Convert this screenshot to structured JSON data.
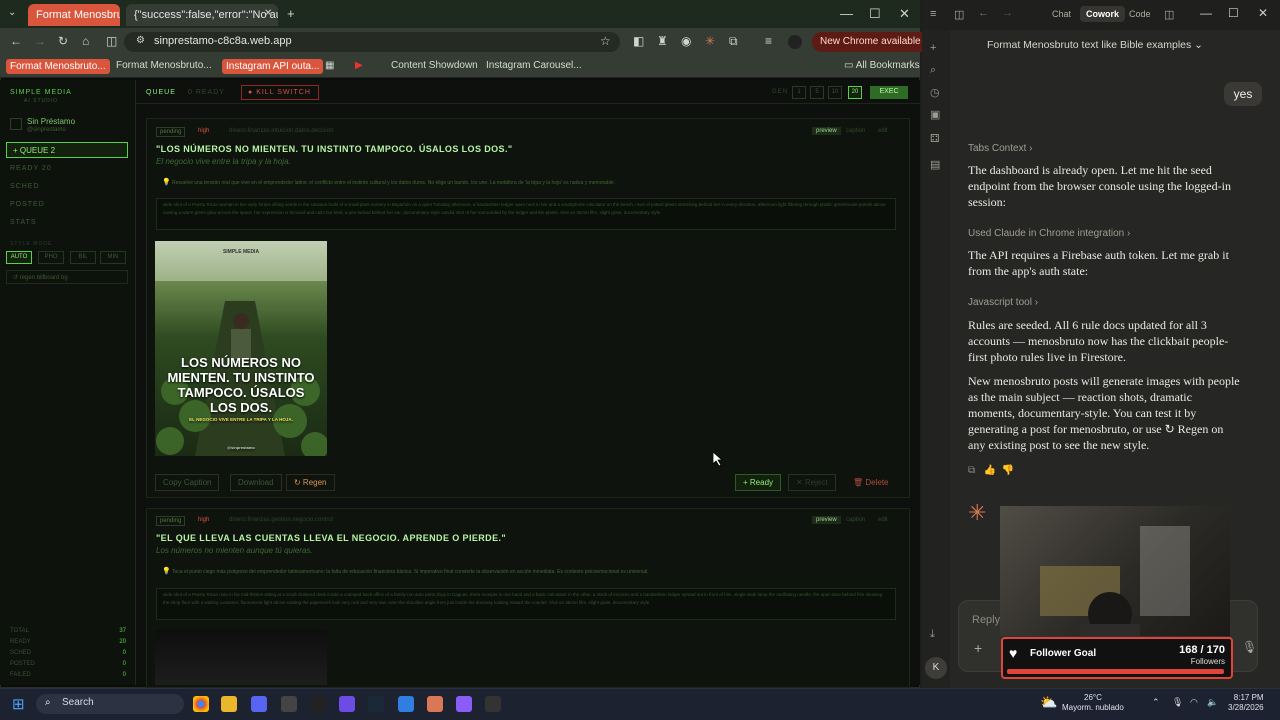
{
  "browser": {
    "tabs": [
      {
        "label": "Format Menosbruto"
      },
      {
        "label": "{\"success\":false,\"error\":\"No auth"
      }
    ],
    "url": "sinprestamo-c8c8a.web.app",
    "new_chrome": "New Chrome available",
    "bookmarks": [
      "Format Menosbruto...",
      "Format Menosbruto...",
      "Instagram API outa...",
      "Content Showdown",
      "Instagram Carousel..."
    ],
    "all_bookmarks": "All Bookmarks"
  },
  "app": {
    "brand": "SIMPLE MEDIA",
    "brand_sub": "AI STUDIO",
    "account_name": "Sin Préstamo",
    "account_handle": "@sinprestamo",
    "nav": [
      {
        "label": "+ QUEUE 2"
      },
      {
        "label": "READY 20"
      },
      {
        "label": "SCHED"
      },
      {
        "label": "POSTED"
      },
      {
        "label": "STATS"
      }
    ],
    "style_mode_label": "STYLE MODE",
    "style_filters": [
      "AUTO",
      "PHO",
      "BIL",
      "MIN"
    ],
    "regen_all": "↺ regen billboard bg",
    "stats": [
      {
        "label": "TOTAL",
        "value": "37"
      },
      {
        "label": "READY",
        "value": "20"
      },
      {
        "label": "SCHED",
        "value": "0"
      },
      {
        "label": "POSTED",
        "value": "0"
      },
      {
        "label": "FAILED",
        "value": "0"
      }
    ],
    "header": {
      "queue": "QUEUE",
      "ready": "0 READY",
      "kill_switch": "KILL SWITCH",
      "gen_label": "GEN",
      "pages": [
        "1",
        "5",
        "10",
        "20"
      ],
      "exec": "EXEC"
    },
    "posts": [
      {
        "status": "pending",
        "priority": "high",
        "tags": "dinero.finanzas.intuicion.datos.decision",
        "modes": [
          "preview",
          "caption",
          "edit"
        ],
        "title": "\"LOS NÚMEROS NO MIENTEN. TU INSTINTO TAMPOCO. ÚSALOS LOS DOS.\"",
        "subtitle": "El negocio vive entre la tripa y la hoja.",
        "note": "Resuelve una tensión real que vive en el emprendedor latino: el conflicto entre el instinto cultural y los datos duros. No elige un bando, los une. La metáfora de 'la tripa y la hoja' es nativa y memorable.",
        "prompt": "wide shot of a Puerto Rican woman in her early forties sifting seeds in the cassava fruits of a small plant nursery in Bayamón on a quiet Tuesday afternoon, a handwritten ledger open next to her and a smartphone calculator on the bench, rows of potted plants stretching behind her in every direction, afternoon light filtering through plastic greenhouse panels above casting a warm green glow across the space, her expression is focused and calm but tired, a pen tucked behind her ear, documentary-style candid shot of her surrounded by the ledger and the plants, shot on 35mm film, slight grain, documentary style",
        "image_caption": "LOS NÚMEROS NO MIENTEN. TU INSTINTO TAMPOCO. ÚSALOS LOS DOS.",
        "image_small": "EL NEGOCIO VIVE ENTRE LA TRIPA Y LA HOJA.",
        "image_top": "SIMPLE MEDIA",
        "image_handle": "@sinprestamo",
        "actions": {
          "copy": "Copy Caption",
          "download": "Download",
          "regen": "↻ Regen",
          "ready": "+ Ready",
          "reject": "✕ Reject",
          "delete": "🗑 Delete"
        }
      },
      {
        "status": "pending",
        "priority": "high",
        "tags": "dinero.finanzas.gestion.negocio.control",
        "modes": [
          "preview",
          "caption",
          "edit"
        ],
        "title": "\"EL QUE LLEVA LAS CUENTAS LLEVA EL NEGOCIO. APRENDE O PIERDE.\"",
        "subtitle": "Los números no mienten aunque tú quieras.",
        "note": "Toca el punto ciego más peligroso del emprendedor latinoamericano: la falta de educación financiera básica. Si imperativo final convierte la observación en acción inmediata. Es contexto psicoemocional es universal.",
        "prompt": "wide shot of a Puerto Rican man in his mid-thirties sitting at a small cluttered desk inside a cramped back office of a family-run auto parts shop in Caguas, three receipts in one hand and a basic calculator in the other, a stack of invoices and a handwritten ledger spread out in front of him, single desk lamp the oscillating needle, the open door behind him showing the shop floor with a waiting customer, fluorescent light above casting the paperwork look very real and very raw, over-the-shoulder angle from just inside the doorway looking toward the counter, shot on 35mm film, slight grain, documentary style"
      }
    ]
  },
  "claude": {
    "modes": [
      "Chat",
      "Cowork",
      "Code"
    ],
    "active_mode": "Cowork",
    "conversation_title": "Format Menosbruto text like Bible examples",
    "user_message": "yes",
    "blocks": [
      {
        "label": "Tabs Context",
        "text": "The dashboard is already open. Let me hit the seed endpoint from the browser console using the logged-in session:"
      },
      {
        "label": "Used Claude in Chrome integration",
        "text": "The API requires a Firebase auth token. Let me grab it from the app's auth state:"
      },
      {
        "label": "Javascript tool",
        "text": "Rules are seeded. All 6 rule docs updated for all 3 accounts — menosbruto now has the clickbait people-first photo rules live in Firestore."
      }
    ],
    "final_text": "New menosbruto posts will generate images with people as the main subject — reaction shots, dramatic moments, documentary-style. You can test it by generating a post for menosbruto, or use ↻ Regen on any existing post to see the new style.",
    "reply_placeholder": "Reply...",
    "avatar": "K",
    "follower_goal": {
      "title": "Follower Goal",
      "count": "168 / 170",
      "unit": "Followers",
      "progress": 0.988
    }
  },
  "taskbar": {
    "search": "Search",
    "weather_temp": "26°C",
    "weather_desc": "Mayorm. nublado",
    "time": "8:17 PM",
    "date": "3/28/2026"
  }
}
